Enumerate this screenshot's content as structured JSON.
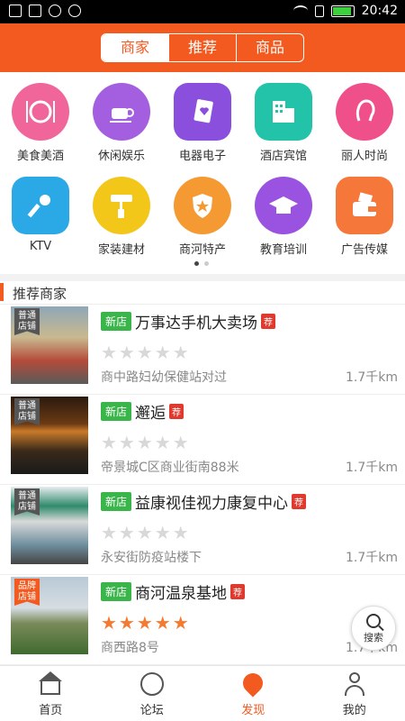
{
  "status_bar": {
    "time": "20:42"
  },
  "header": {
    "tabs": [
      "商家",
      "推荐",
      "商品"
    ]
  },
  "categories": [
    {
      "label": "美食美酒",
      "icon": "dining-icon",
      "color": "#f0669a"
    },
    {
      "label": "休闲娱乐",
      "icon": "coffee-icon",
      "color": "#a45fe0"
    },
    {
      "label": "电器电子",
      "icon": "cards-icon",
      "color": "#8a4fdc"
    },
    {
      "label": "酒店宾馆",
      "icon": "building-icon",
      "color": "#22c3a8"
    },
    {
      "label": "丽人时尚",
      "icon": "woman-icon",
      "color": "#f0508a"
    },
    {
      "label": "KTV",
      "icon": "microphone-icon",
      "color": "#2aa9e6"
    },
    {
      "label": "家装建材",
      "icon": "paint-roller-icon",
      "color": "#f3c61a"
    },
    {
      "label": "商河特产",
      "icon": "shield-star-icon",
      "color": "#f59a32"
    },
    {
      "label": "教育培训",
      "icon": "graduation-cap-icon",
      "color": "#9a52e0"
    },
    {
      "label": "广告传媒",
      "icon": "wallet-icon",
      "color": "#f5773a"
    }
  ],
  "section_title": "推荐商家",
  "merchants": [
    {
      "badge": "普通店铺",
      "badge_color": "#555555",
      "tag": "新店",
      "name": "万事达手机大卖场",
      "rec": "荐",
      "rating": 0,
      "address": "商中路妇幼保健站对过",
      "distance": "1.7千km"
    },
    {
      "badge": "普通店铺",
      "badge_color": "#555555",
      "tag": "新店",
      "name": "邂逅",
      "rec": "荐",
      "rating": 0,
      "address": "帝景城C区商业街南88米",
      "distance": "1.7千km"
    },
    {
      "badge": "普通店铺",
      "badge_color": "#555555",
      "tag": "新店",
      "name": "益康视佳视力康复中心",
      "rec": "荐",
      "rating": 0,
      "address": "永安街防疫站楼下",
      "distance": "1.7千km"
    },
    {
      "badge": "品牌店铺",
      "badge_color": "#f35a1f",
      "tag": "新店",
      "name": "商河温泉基地",
      "rec": "荐",
      "rating": 5,
      "address": "商西路8号",
      "distance": "1.7千km"
    }
  ],
  "search_fab": "搜索",
  "tabbar": [
    {
      "label": "首页",
      "icon": "home-icon"
    },
    {
      "label": "论坛",
      "icon": "compass-icon"
    },
    {
      "label": "发现",
      "icon": "location-pin-icon",
      "active": true
    },
    {
      "label": "我的",
      "icon": "person-icon"
    }
  ]
}
